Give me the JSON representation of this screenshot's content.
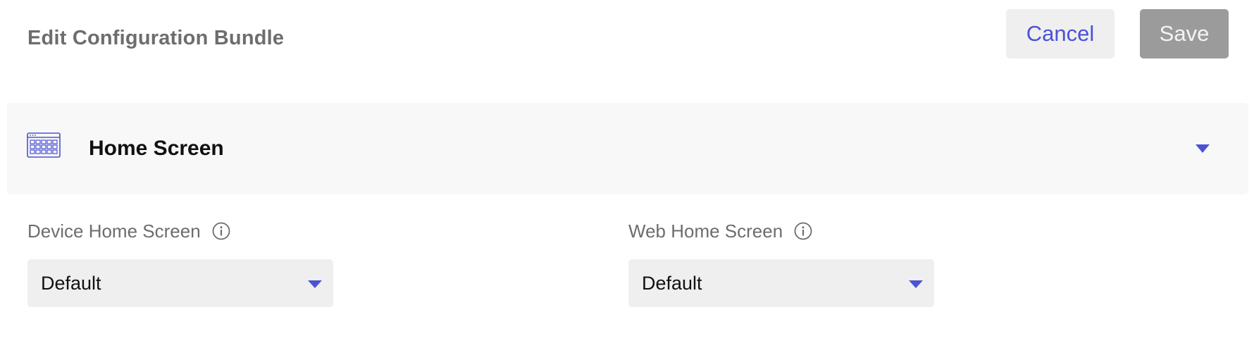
{
  "header": {
    "title": "Edit Configuration Bundle",
    "cancel_label": "Cancel",
    "save_label": "Save"
  },
  "section": {
    "title": "Home Screen",
    "icon": "home-screen-grid-icon",
    "expanded": true
  },
  "fields": {
    "device_home_screen": {
      "label": "Device Home Screen",
      "value": "Default"
    },
    "web_home_screen": {
      "label": "Web Home Screen",
      "value": "Default"
    }
  },
  "colors": {
    "accent": "#4a52d6",
    "save_disabled": "#9b9b9b",
    "cancel_bg": "#efefef",
    "section_bg": "#f8f8f8",
    "label": "#6d6d6d"
  }
}
